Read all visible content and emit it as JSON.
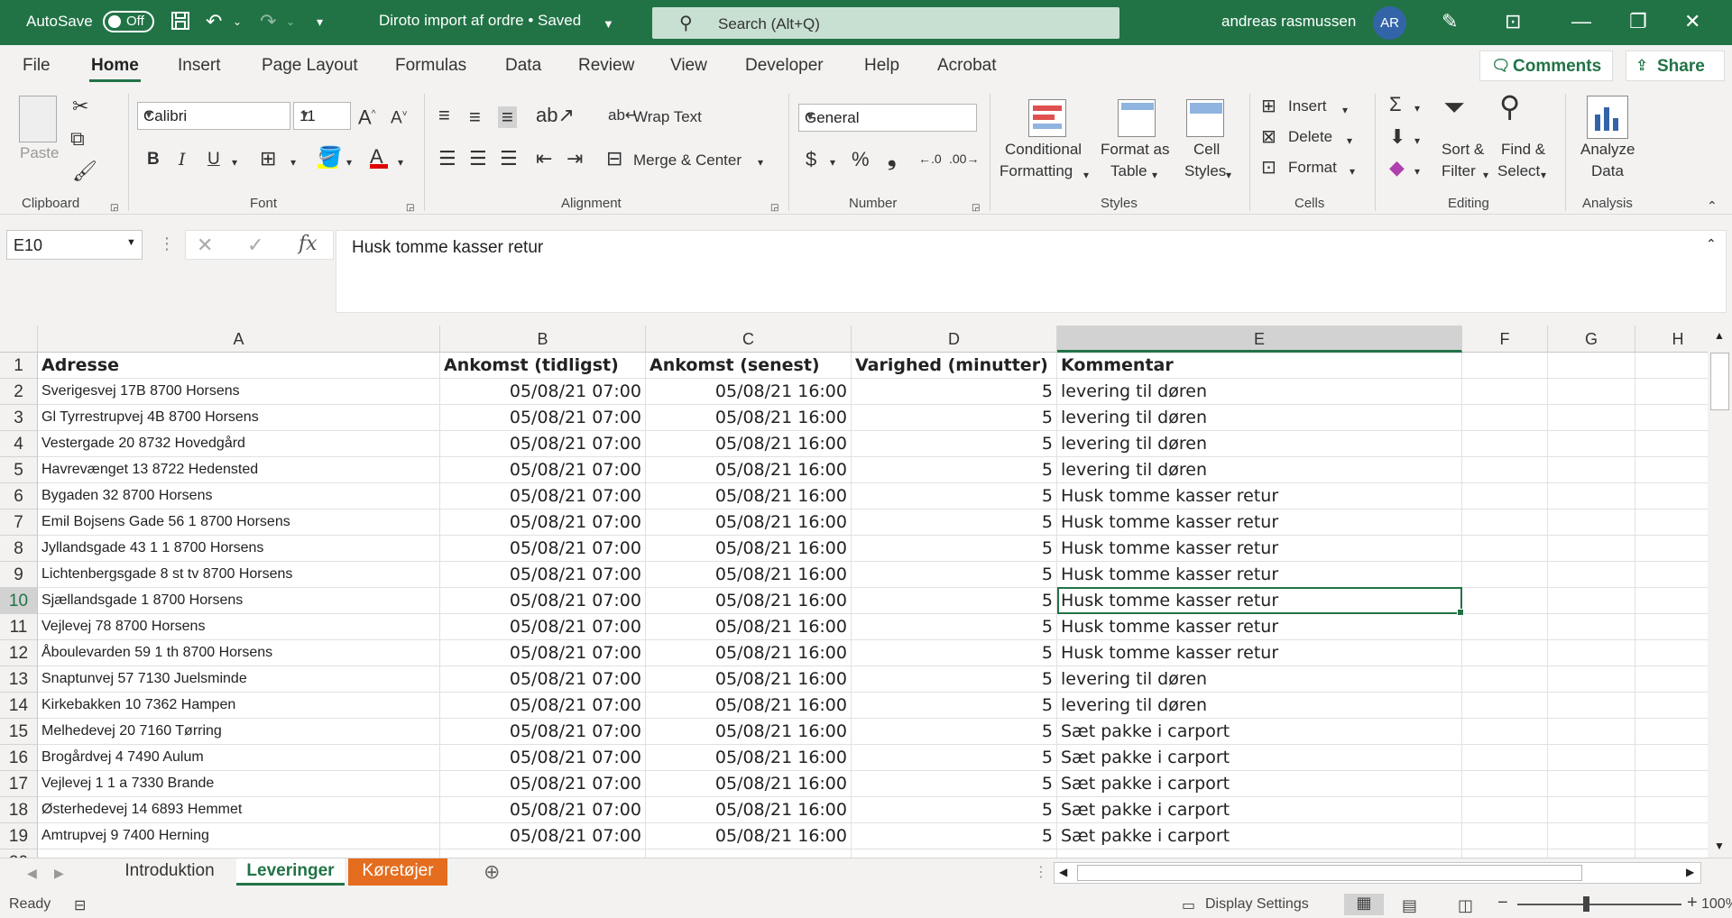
{
  "titlebar": {
    "autosave_label": "AutoSave",
    "autosave_state": "Off",
    "doc_title": "Diroto import af ordre • Saved",
    "search_placeholder": "Search (Alt+Q)",
    "user_name": "andreas rasmussen",
    "avatar_initials": "AR"
  },
  "menu": {
    "tabs": [
      "File",
      "Home",
      "Insert",
      "Page Layout",
      "Formulas",
      "Data",
      "Review",
      "View",
      "Developer",
      "Help",
      "Acrobat"
    ],
    "active": "Home",
    "comments_label": "Comments",
    "share_label": "Share"
  },
  "ribbon": {
    "clipboard": {
      "paste": "Paste",
      "label": "Clipboard"
    },
    "font": {
      "name": "Calibri",
      "size": "11",
      "label": "Font",
      "bold": "B",
      "italic": "I",
      "underline": "U"
    },
    "alignment": {
      "wrap_text": "Wrap Text",
      "merge_center": "Merge & Center",
      "label": "Alignment"
    },
    "number": {
      "format": "General",
      "label": "Number",
      "currency": "$",
      "percent": "%",
      "comma": "❟"
    },
    "styles": {
      "conditional": "Conditional",
      "conditional2": "Formatting",
      "format_as": "Format as",
      "format_as2": "Table",
      "cell": "Cell",
      "cell2": "Styles",
      "label": "Styles"
    },
    "cells": {
      "insert": "Insert",
      "delete": "Delete",
      "format": "Format",
      "label": "Cells"
    },
    "editing": {
      "sort": "Sort &",
      "sort2": "Filter",
      "find": "Find &",
      "find2": "Select",
      "label": "Editing"
    },
    "analysis": {
      "analyze": "Analyze",
      "analyze2": "Data",
      "label": "Analysis"
    }
  },
  "formula_bar": {
    "name_box": "E10",
    "fx": "fx",
    "content": "Husk tomme kasser retur"
  },
  "sheet": {
    "columns": [
      "A",
      "B",
      "C",
      "D",
      "E",
      "F",
      "G",
      "H"
    ],
    "selected_column": "E",
    "selected_row": 10,
    "header_row": [
      "Adresse",
      "Ankomst (tidligst)",
      "Ankomst (senest)",
      "Varighed (minutter)",
      "Kommentar"
    ],
    "rows": [
      [
        "Sverigesvej 17B   8700 Horsens",
        "05/08/21 07:00",
        "05/08/21 16:00",
        "5",
        "levering til døren"
      ],
      [
        "Gl Tyrrestrupvej 4B   8700 Horsens",
        "05/08/21 07:00",
        "05/08/21 16:00",
        "5",
        "levering til døren"
      ],
      [
        "Vestergade 20   8732 Hovedgård",
        "05/08/21 07:00",
        "05/08/21 16:00",
        "5",
        "levering til døren"
      ],
      [
        "Havrevænget 13   8722 Hedensted",
        "05/08/21 07:00",
        "05/08/21 16:00",
        "5",
        "levering til døren"
      ],
      [
        "Bygaden 32   8700 Horsens",
        "05/08/21 07:00",
        "05/08/21 16:00",
        "5",
        "Husk tomme kasser retur"
      ],
      [
        "Emil Bojsens Gade 56 1  8700 Horsens",
        "05/08/21 07:00",
        "05/08/21 16:00",
        "5",
        "Husk tomme kasser retur"
      ],
      [
        "Jyllandsgade 43 1 1 8700 Horsens",
        "05/08/21 07:00",
        "05/08/21 16:00",
        "5",
        "Husk tomme kasser retur"
      ],
      [
        "Lichtenbergsgade 8 st tv 8700 Horsens",
        "05/08/21 07:00",
        "05/08/21 16:00",
        "5",
        "Husk tomme kasser retur"
      ],
      [
        "Sjællandsgade 1   8700 Horsens",
        "05/08/21 07:00",
        "05/08/21 16:00",
        "5",
        "Husk tomme kasser retur"
      ],
      [
        "Vejlevej 78   8700 Horsens",
        "05/08/21 07:00",
        "05/08/21 16:00",
        "5",
        "Husk tomme kasser retur"
      ],
      [
        "Åboulevarden 59 1 th 8700 Horsens",
        "05/08/21 07:00",
        "05/08/21 16:00",
        "5",
        "Husk tomme kasser retur"
      ],
      [
        "Snaptunvej 57   7130 Juelsminde",
        "05/08/21 07:00",
        "05/08/21 16:00",
        "5",
        "levering til døren"
      ],
      [
        "Kirkebakken 10   7362 Hampen",
        "05/08/21 07:00",
        "05/08/21 16:00",
        "5",
        "levering til døren"
      ],
      [
        "Melhedevej 20   7160 Tørring",
        "05/08/21 07:00",
        "05/08/21 16:00",
        "5",
        "Sæt pakke i carport"
      ],
      [
        "Brogårdvej 4   7490 Aulum",
        "05/08/21 07:00",
        "05/08/21 16:00",
        "5",
        "Sæt pakke i carport"
      ],
      [
        "Vejlevej 1 1 a 7330 Brande",
        "05/08/21 07:00",
        "05/08/21 16:00",
        "5",
        "Sæt pakke i carport"
      ],
      [
        "Østerhedevej 14   6893 Hemmet",
        "05/08/21 07:00",
        "05/08/21 16:00",
        "5",
        "Sæt pakke i carport"
      ],
      [
        "Amtrupvej 9   7400 Herning",
        "05/08/21 07:00",
        "05/08/21 16:00",
        "5",
        "Sæt pakke i carport"
      ]
    ]
  },
  "sheet_tabs": [
    {
      "label": "Introduktion",
      "state": "normal"
    },
    {
      "label": "Leveringer",
      "state": "active"
    },
    {
      "label": "Køretøjer",
      "state": "orange"
    }
  ],
  "statusbar": {
    "ready": "Ready",
    "display_settings": "Display Settings",
    "zoom": "100%"
  },
  "colors": {
    "accent": "#217346",
    "orange_tab": "#e46d1f"
  }
}
